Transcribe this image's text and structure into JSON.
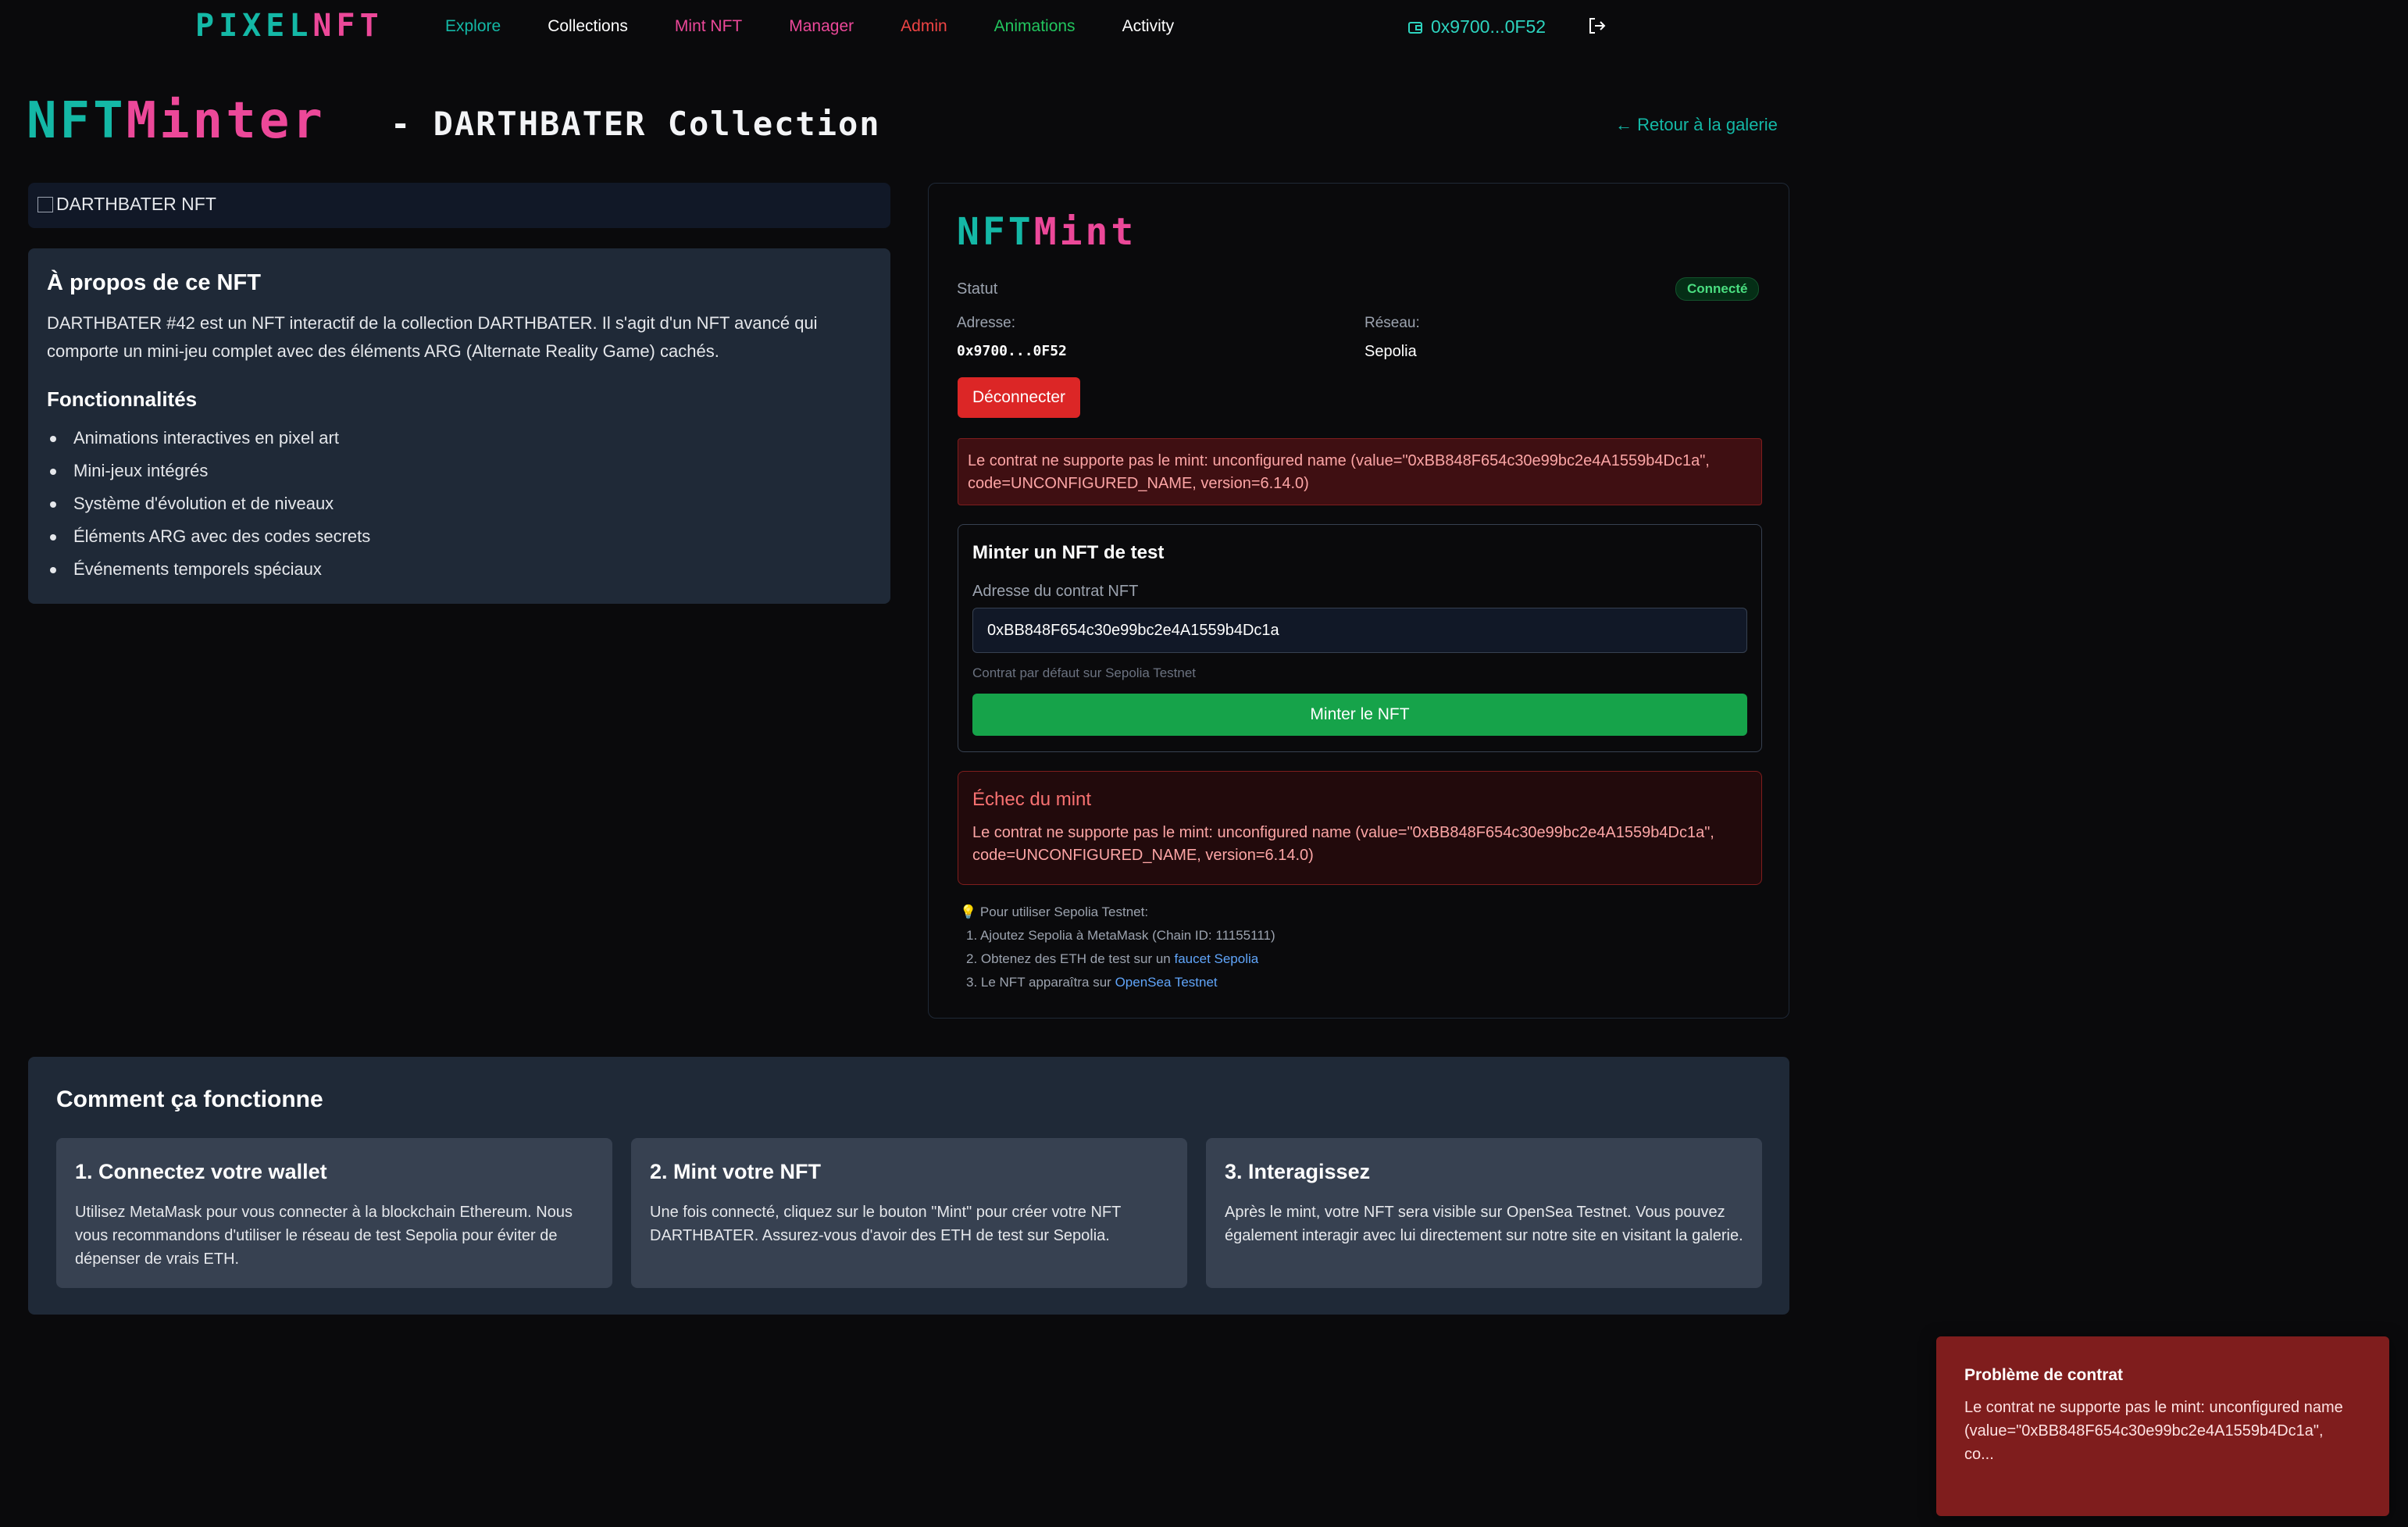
{
  "nav": {
    "logo_a": "PIXEL",
    "logo_b": "NFT",
    "links": [
      {
        "label": "Explore",
        "color": "#14b8a6"
      },
      {
        "label": "Collections",
        "color": "#ffffff"
      },
      {
        "label": "Mint NFT",
        "color": "#ec4899"
      },
      {
        "label": "Manager",
        "color": "#ec4899"
      },
      {
        "label": "Admin",
        "color": "#ef4444"
      },
      {
        "label": "Animations",
        "color": "#22c55e"
      },
      {
        "label": "Activity",
        "color": "#ffffff"
      }
    ],
    "wallet_address": "0x9700...0F52",
    "wallet_icon": "wallet-icon",
    "logout_icon": "logout-icon"
  },
  "header": {
    "title_a": "NFT",
    "title_b": "Minter",
    "subtitle": "- DARTHBATER Collection",
    "back_link": "← Retour à la galerie"
  },
  "nft_image": {
    "alt": "DARTHBATER NFT"
  },
  "about": {
    "title": "À propos de ce NFT",
    "description": "DARTHBATER #42 est un NFT interactif de la collection DARTHBATER. Il s'agit d'un NFT avancé qui comporte un mini-jeu complet avec des éléments ARG (Alternate Reality Game) cachés.",
    "features_title": "Fonctionnalités",
    "features": [
      "Animations interactives en pixel art",
      "Mini-jeux intégrés",
      "Système d'évolution et de niveaux",
      "Éléments ARG avec des codes secrets",
      "Événements temporels spéciaux"
    ]
  },
  "mint": {
    "title_a": "NFT",
    "title_b": "Mint",
    "status_label": "Statut",
    "status_value": "Connecté",
    "address_label": "Adresse:",
    "address_value": "0x9700...0F52",
    "network_label": "Réseau:",
    "network_value": "Sepolia",
    "disconnect_label": "Déconnecter",
    "error_message": "Le contrat ne supporte pas le mint: unconfigured name (value=\"0xBB848F654c30e99bc2e4A1559b4Dc1a\", code=UNCONFIGURED_NAME, version=6.14.0)",
    "test_title": "Minter un NFT de test",
    "contract_label": "Adresse du contrat NFT",
    "contract_value": "0xBB848F654c30e99bc2e4A1559b4Dc1a",
    "contract_hint": "Contrat par défaut sur Sepolia Testnet",
    "mint_button": "Minter le NFT",
    "fail_title": "Échec du mint",
    "fail_message": "Le contrat ne supporte pas le mint: unconfigured name (value=\"0xBB848F654c30e99bc2e4A1559b4Dc1a\", code=UNCONFIGURED_NAME, version=6.14.0)",
    "instructions": {
      "bulb": "💡",
      "heading": "Pour utiliser Sepolia Testnet:",
      "step1": "1. Ajoutez Sepolia à MetaMask (Chain ID: 11155111)",
      "step2_prefix": "2. Obtenez des ETH de test sur un",
      "step2_link": "faucet Sepolia",
      "step3_prefix": "3. Le NFT apparaîtra sur",
      "step3_link": "OpenSea Testnet"
    }
  },
  "how": {
    "title": "Comment ça fonctionne",
    "cards": [
      {
        "title": "1. Connectez votre wallet",
        "text": "Utilisez MetaMask pour vous connecter à la blockchain Ethereum. Nous vous recommandons d'utiliser le réseau de test Sepolia pour éviter de dépenser de vrais ETH."
      },
      {
        "title": "2. Mint votre NFT",
        "text": "Une fois connecté, cliquez sur le bouton \"Mint\" pour créer votre NFT DARTHBATER. Assurez-vous d'avoir des ETH de test sur Sepolia."
      },
      {
        "title": "3. Interagissez",
        "text": "Après le mint, votre NFT sera visible sur OpenSea Testnet. Vous pouvez également interagir avec lui directement sur notre site en visitant la galerie."
      }
    ]
  },
  "toast": {
    "title": "Problème de contrat",
    "message": "Le contrat ne supporte pas le mint: unconfigured name (value=\"0xBB848F654c30e99bc2e4A1559b4Dc1a\", co..."
  }
}
